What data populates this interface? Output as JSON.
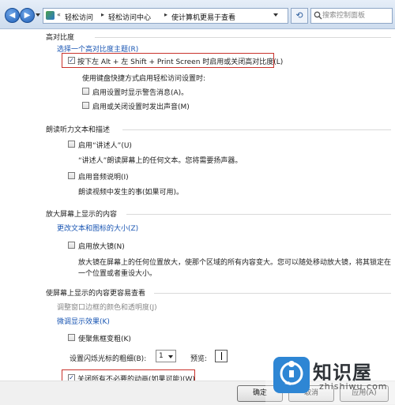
{
  "nav": {
    "back_glyph": "◀",
    "forward_glyph": "▶",
    "breadcrumb_prefix": "«",
    "breadcrumbs": [
      "轻松访问",
      "轻松访问中心",
      "使计算机更易于查看"
    ],
    "refresh_glyph": "⟲",
    "search_placeholder": "搜索控制面板"
  },
  "high_contrast": {
    "title": "高对比度",
    "theme_link": "选择一个高对比度主题(R)",
    "shortcut_label": "按下左 Alt + 左 Shift + Print Screen 时启用或关闭高对比度(L)",
    "shortcut_checked": true,
    "shortcut_settings_label": "使用键盘快捷方式启用轻松访问设置时:",
    "warning_label": "启用设置时显示警告消息(A)。",
    "sound_label": "启用或关闭设置时发出声音(M)"
  },
  "narrator": {
    "title": "朗读听力文本和描述",
    "enable_label": "启用“讲述人”(U)",
    "enable_desc": "“讲述人”朗读屏幕上的任何文本。您将需要扬声器。",
    "audio_desc_label": "启用音频说明(I)",
    "audio_desc_desc": "朗读视频中发生的事(如果可用)。"
  },
  "magnify": {
    "title": "放大屏幕上显示的内容",
    "text_size_link": "更改文本和图标的大小(Z)",
    "magnifier_label": "启用放大镜(N)",
    "magnifier_desc_1": "放大镜在屏幕上的任何位置放大，使那个区域的所有内容变大。您可以随处移动放大镜，将其锁定在",
    "magnifier_desc_2": "一个位置或者重设大小。"
  },
  "visual": {
    "title": "使屏幕上显示的内容更容易查看",
    "window_border_link": "调整窗口边框的颜色和透明度(J)",
    "display_effects_link": "微调显示效果(K)",
    "focus_label": "使聚焦框变粗(K)",
    "cursor_label": "设置闪烁光标的粗细(B):",
    "cursor_value": "1",
    "preview_label": "预览:",
    "animations_label": "关闭所有不必要的动画(如果可能)(W)",
    "animations_checked": true
  },
  "checkbox_mark": "✓",
  "buttons": {
    "ok": "确定",
    "cancel": "取消",
    "apply": "应用(A)"
  },
  "watermark": {
    "brand": "知识屋",
    "site": "zhishiwu.com"
  },
  "colors": {
    "link": "#1a56b3",
    "highlight_box": "#c9322b",
    "logo": "#2e86d4"
  }
}
